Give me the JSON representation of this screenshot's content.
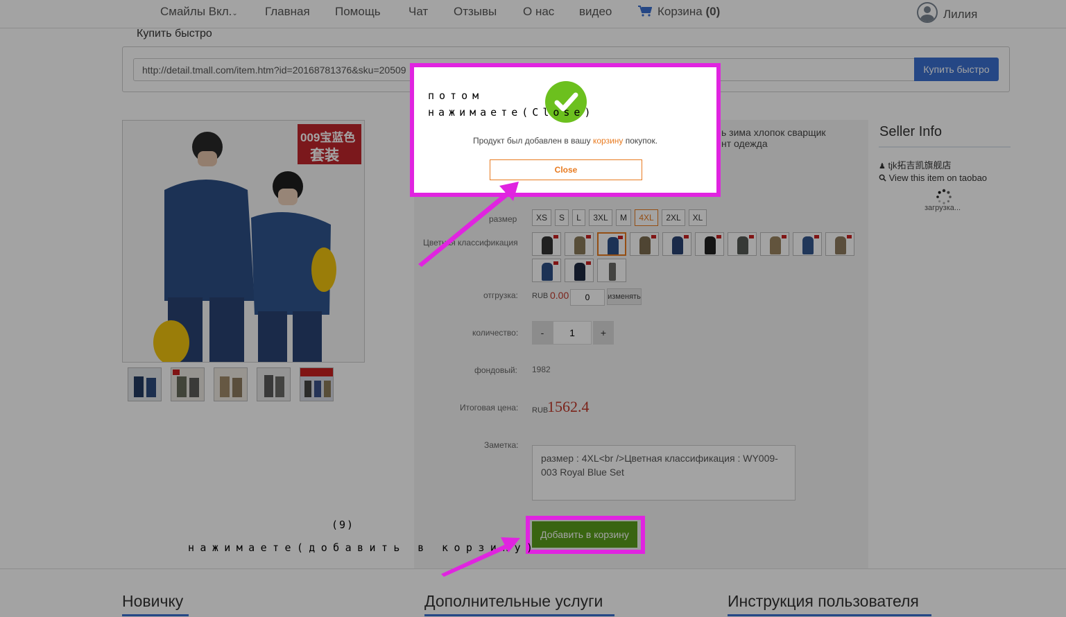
{
  "nav": {
    "smiles": "Смайлы Вкл.",
    "home": "Главная",
    "help": "Помощь",
    "chat": "Чат",
    "reviews": "Отзывы",
    "about": "О нас",
    "video": "видео",
    "cart_label": "Корзина",
    "cart_count": "(0)",
    "user_name": "Лилия"
  },
  "quick_buy": {
    "title": "Купить быстро",
    "url_value": "http://detail.tmall.com/item.htm?id=20168781376&sku=20509",
    "button": "Купить быстро"
  },
  "product": {
    "title_line1": "ь зима хлопок сварщик",
    "title_line2": "нт одежда",
    "image_badge_line1": "009宝蓝色",
    "image_badge_line2": "套装",
    "size_label": "размер",
    "sizes": [
      "XS",
      "S",
      "L",
      "3XL",
      "M",
      "4XL",
      "2XL",
      "XL"
    ],
    "selected_size": "4XL",
    "color_label": "Цветная классификация",
    "shipping_label": "отгрузка:",
    "shipping_currency": "RUB",
    "shipping_value": "0.00",
    "shipping_input": "0",
    "shipping_button": "изменять",
    "quantity_label": "количество:",
    "qty_minus": "-",
    "qty_value": "1",
    "qty_plus": "+",
    "stock_label": "фондовый:",
    "stock_value": "1982",
    "total_label": "Итоговая цена:",
    "total_currency": "RUB",
    "total_value": "1562.4",
    "note_label": "Заметка:",
    "note_value": "размер : 4XL<br />Цветная классификация : WY009-003 Royal Blue Set",
    "add_to_cart": "Добавить в корзину"
  },
  "seller": {
    "title": "Seller Info",
    "name": "tjk拓吉凯旗舰店",
    "view_on_taobao": "View this item on taobao",
    "loading": "загрузка..."
  },
  "footer": {
    "col1": "Новичку",
    "col2": "Дополнительные услуги",
    "col3": "Инструкция пользователя"
  },
  "modal": {
    "message_before": "Продукт был добавлен в вашу ",
    "message_link": "корзину",
    "message_after": " покупок.",
    "close_button": "Close"
  },
  "annotations": {
    "top_line1": "потом",
    "top_line2": "нажимаете(Close)",
    "step_number": "(9)",
    "bottom_text": "нажимаете(добавить в корзину)"
  },
  "colors": {
    "accent_blue": "#3a6fd1",
    "add_cart_green": "#5a9e1c",
    "price_red": "#c0392b",
    "selected_orange": "#e87a1f",
    "annotation_magenta": "#e024e0",
    "success_green": "#6cc01e"
  }
}
